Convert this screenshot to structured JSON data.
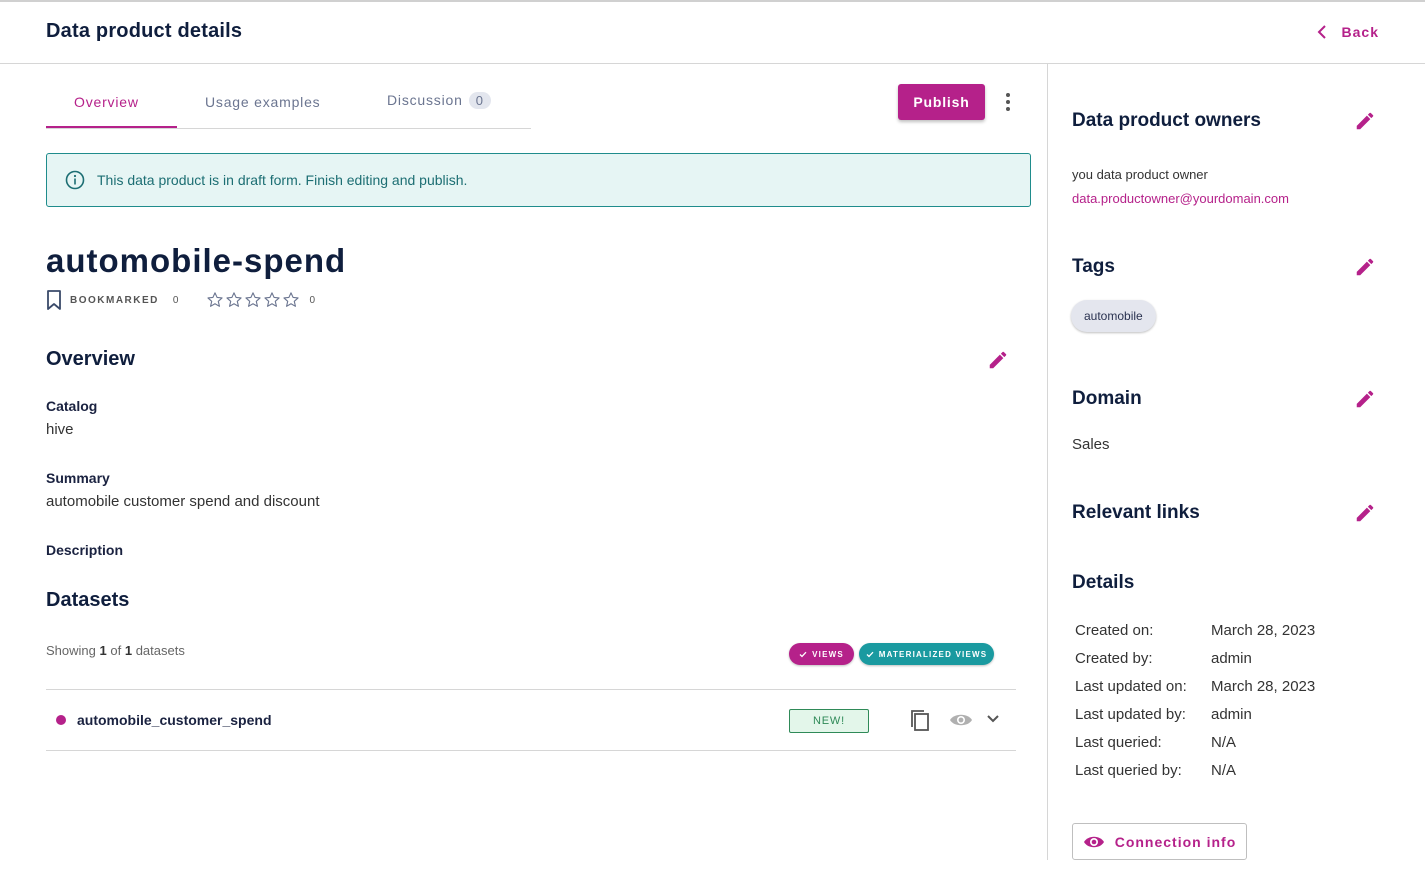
{
  "header": {
    "title": "Data product details",
    "back_label": "Back"
  },
  "tabs": [
    {
      "label": "Overview",
      "active": true
    },
    {
      "label": "Usage examples",
      "active": false
    },
    {
      "label": "Discussion",
      "active": false,
      "badge": "0"
    }
  ],
  "actions": {
    "publish_label": "Publish"
  },
  "banner": {
    "message": "This data product is in draft form. Finish editing and publish."
  },
  "product": {
    "name": "automobile-spend",
    "bookmark_label": "BOOKMARKED",
    "bookmark_count": "0",
    "rating_count": "0",
    "rating_value": 0
  },
  "overview": {
    "title": "Overview",
    "catalog_label": "Catalog",
    "catalog_value": "hive",
    "summary_label": "Summary",
    "summary_value": "automobile customer spend and discount",
    "description_label": "Description"
  },
  "datasets": {
    "title": "Datasets",
    "showing_prefix": "Showing",
    "showing_count": "1",
    "showing_of": "of",
    "showing_total": "1",
    "showing_suffix": "datasets",
    "filters": [
      "VIEWS",
      "MATERIALIZED VIEWS"
    ],
    "rows": [
      {
        "name": "automobile_customer_spend",
        "badge": "NEW!"
      }
    ]
  },
  "sidebar": {
    "owners_title": "Data product owners",
    "owner_name": "you data product owner",
    "owner_email": "data.productowner@yourdomain.com",
    "tags_title": "Tags",
    "tags": [
      "automobile"
    ],
    "domain_title": "Domain",
    "domain_value": "Sales",
    "links_title": "Relevant links",
    "details_title": "Details",
    "details": [
      {
        "key": "Created on:",
        "value": "March 28, 2023"
      },
      {
        "key": "Created by:",
        "value": "admin"
      },
      {
        "key": "Last updated on:",
        "value": "March 28, 2023"
      },
      {
        "key": "Last updated by:",
        "value": "admin"
      },
      {
        "key": "Last queried:",
        "value": "N/A"
      },
      {
        "key": "Last queried by:",
        "value": "N/A"
      }
    ],
    "connection_label": "Connection info"
  },
  "colors": {
    "accent": "#b5218a",
    "teal": "#1a9aa0",
    "navy": "#0f1e3d",
    "banner_bg": "#e6f5f4",
    "success": "#2f8a58"
  }
}
